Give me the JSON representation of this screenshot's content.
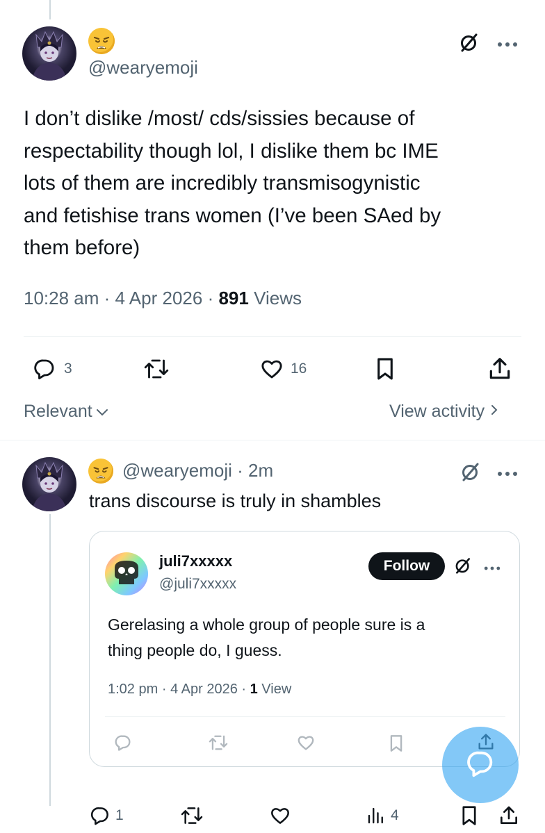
{
  "main_post": {
    "handle": "@wearyemoji",
    "text_lines": [
      "I don’t dislike /most/ cds/sissies because of",
      "respectability though lol, I dislike them bc IME",
      "lots of them are incredibly transmisogynistic",
      "and fetishise trans women (I’ve been SAed by",
      "them before)"
    ],
    "time": "10:28 am",
    "date": "4 Apr 2026",
    "views_count": "891",
    "views_label": "Views",
    "sep": "·",
    "actions": {
      "replies": "3",
      "likes": "16"
    }
  },
  "replies_bar": {
    "sort_label": "Relevant",
    "view_activity": "View activity"
  },
  "reply": {
    "handle": "@wearyemoji",
    "age": "2m",
    "text": "trans discourse is truly in shambles",
    "actions": {
      "replies": "1",
      "views": "4"
    },
    "quote": {
      "display_name": "juli7xxxxx",
      "handle": "@juli7xxxxx",
      "follow_label": "Follow",
      "text_lines": [
        "Gerelasing a whole group of people sure is a",
        "thing people do, I guess."
      ],
      "time": "1:02 pm",
      "date": "4 Apr 2026",
      "views_count": "1",
      "views_label": "View"
    }
  },
  "colors": {
    "accent": "#1d9bf0",
    "muted": "#536471",
    "border": "#cfd9de",
    "text": "#0f1419"
  },
  "icons": [
    "weary-face-emoji",
    "grok-slash-icon",
    "more-icon",
    "reply-icon",
    "repost-icon",
    "like-icon",
    "bookmark-icon",
    "share-icon",
    "views-icon",
    "chevron-down-icon",
    "chevron-right-icon",
    "compose-reply-icon"
  ]
}
